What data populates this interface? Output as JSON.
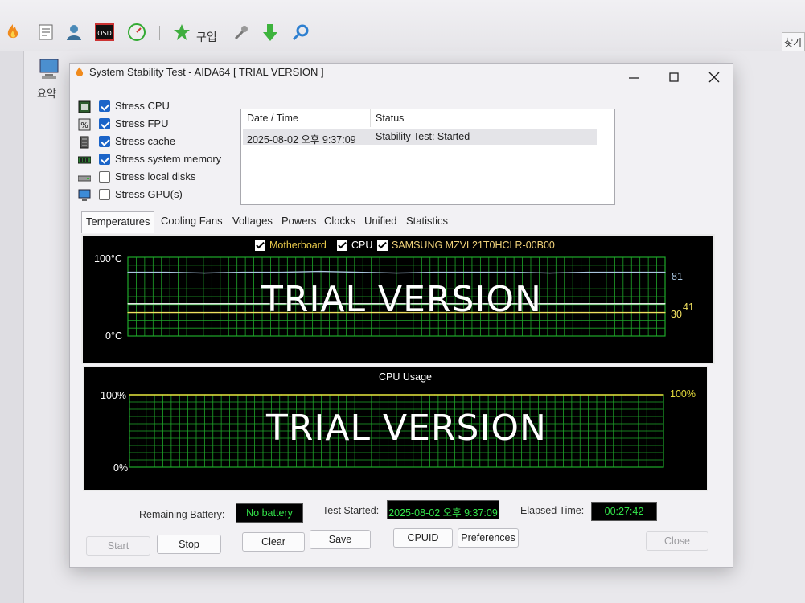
{
  "host": {
    "toolbar": {
      "buy_label": "구입"
    },
    "side_label": "요약",
    "find_label": "찾기"
  },
  "window": {
    "title": "System Stability Test - AIDA64  [ TRIAL VERSION ]",
    "stress_options": [
      {
        "label": "Stress CPU",
        "checked": true,
        "icon": "cpu-chip-icon"
      },
      {
        "label": "Stress FPU",
        "checked": true,
        "icon": "fpu-percent-icon"
      },
      {
        "label": "Stress cache",
        "checked": true,
        "icon": "cache-icon"
      },
      {
        "label": "Stress system memory",
        "checked": true,
        "icon": "memory-module-icon"
      },
      {
        "label": "Stress local disks",
        "checked": false,
        "icon": "disk-drive-icon"
      },
      {
        "label": "Stress GPU(s)",
        "checked": false,
        "icon": "monitor-icon"
      }
    ],
    "log": {
      "columns": [
        "Date / Time",
        "Status"
      ],
      "rows": [
        {
          "datetime": "2025-08-02 오후 9:37:09",
          "status": "Stability Test: Started"
        }
      ]
    },
    "tabs": [
      "Temperatures",
      "Cooling Fans",
      "Voltages",
      "Powers",
      "Clocks",
      "Unified",
      "Statistics"
    ],
    "active_tab": "Temperatures",
    "temp_graph": {
      "legend": [
        {
          "label": "Motherboard",
          "checked": true,
          "color": "#e8c84a"
        },
        {
          "label": "CPU",
          "checked": true,
          "color": "#ffffff"
        },
        {
          "label": "SAMSUNG MZVL21T0HCLR-00B00",
          "checked": true,
          "color": "#f0d27a"
        }
      ],
      "y_max_label": "100°C",
      "y_min_label": "0°C",
      "watermark": "TRIAL VERSION",
      "right_labels": {
        "cpu": "81",
        "ssd": "41",
        "motherboard": "30"
      }
    },
    "cpu_graph": {
      "title": "CPU Usage",
      "y_max_label": "100%",
      "y_min_label": "0%",
      "watermark": "TRIAL VERSION",
      "right_label": "100%"
    },
    "status": {
      "battery_label": "Remaining Battery:",
      "battery_value": "No battery",
      "started_label": "Test Started:",
      "started_value": "2025-08-02 오후 9:37:09",
      "elapsed_label": "Elapsed Time:",
      "elapsed_value": "00:27:42"
    },
    "buttons": {
      "start": "Start",
      "stop": "Stop",
      "clear": "Clear",
      "save": "Save",
      "cpuid": "CPUID",
      "preferences": "Preferences",
      "close": "Close"
    }
  },
  "colors": {
    "grid": "#1fa82a",
    "cpu_line": "#a9c4de",
    "motherboard_line": "#f0e060",
    "ssd_line": "#ffffff",
    "usage_line": "#e6dc3c",
    "status_text": "#33e44a"
  },
  "chart_data": [
    {
      "type": "line",
      "title": "",
      "ylim": [
        0,
        100
      ],
      "series": [
        {
          "name": "CPU",
          "values": [
            81,
            81,
            80,
            81,
            81,
            82,
            81,
            80,
            81,
            81,
            81,
            80,
            81,
            81,
            81
          ]
        },
        {
          "name": "SAMSUNG MZVL21T0HCLR-00B00",
          "values": [
            41,
            41,
            41,
            41,
            41,
            41,
            41,
            41,
            41,
            41,
            41,
            41,
            41,
            41,
            41
          ]
        },
        {
          "name": "Motherboard",
          "values": [
            30,
            30,
            30,
            30,
            30,
            30,
            30,
            30,
            30,
            30,
            30,
            30,
            30,
            30,
            30
          ]
        }
      ],
      "grid": true
    },
    {
      "type": "line",
      "title": "CPU Usage",
      "ylim": [
        0,
        100
      ],
      "series": [
        {
          "values": [
            100,
            100,
            100,
            100,
            100,
            100,
            100,
            100,
            100,
            100,
            100,
            100,
            100,
            100,
            100
          ]
        }
      ],
      "grid": true
    }
  ]
}
